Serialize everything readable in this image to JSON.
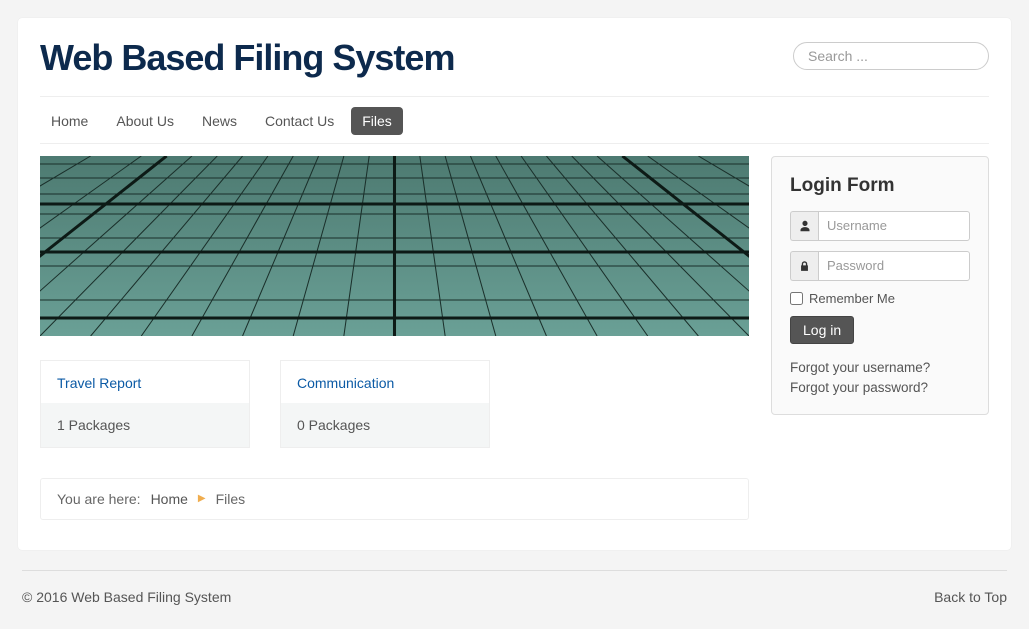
{
  "site": {
    "title": "Web Based Filing System"
  },
  "search": {
    "placeholder": "Search ..."
  },
  "nav": {
    "items": [
      {
        "label": "Home"
      },
      {
        "label": "About Us"
      },
      {
        "label": "News"
      },
      {
        "label": "Contact Us"
      },
      {
        "label": "Files",
        "active": true
      }
    ]
  },
  "cards": [
    {
      "title": "Travel Report",
      "count_text": "1 Packages"
    },
    {
      "title": "Communication",
      "count_text": "0 Packages"
    }
  ],
  "breadcrumb": {
    "prefix": "You are here:",
    "items": [
      "Home",
      "Files"
    ]
  },
  "login": {
    "title": "Login Form",
    "username_placeholder": "Username",
    "password_placeholder": "Password",
    "remember_label": "Remember Me",
    "button_label": "Log in",
    "forgot_username": "Forgot your username?",
    "forgot_password": "Forgot your password?"
  },
  "footer": {
    "copyright": "© 2016 Web Based Filing System",
    "back_to_top": "Back to Top"
  }
}
